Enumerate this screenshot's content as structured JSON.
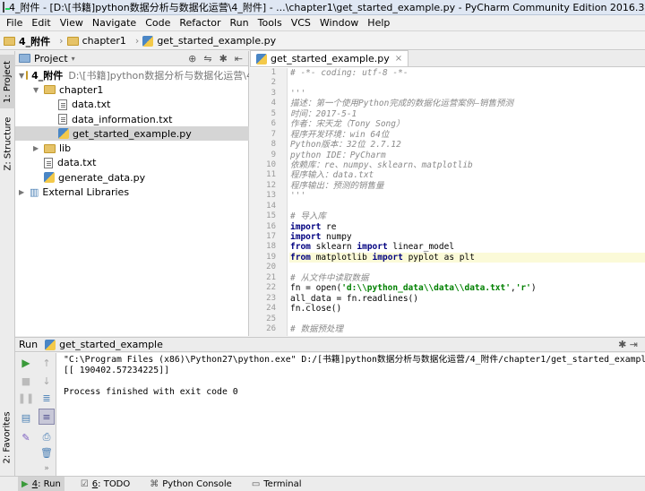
{
  "window": {
    "title": "4_附件 - [D:\\[书籍]python数据分析与数据化运营\\4_附件] - ...\\chapter1\\get_started_example.py - PyCharm Community Edition 2016.3.2"
  },
  "menu": [
    "File",
    "Edit",
    "View",
    "Navigate",
    "Code",
    "Refactor",
    "Run",
    "Tools",
    "VCS",
    "Window",
    "Help"
  ],
  "breadcrumb": [
    "4_附件",
    "chapter1",
    "get_started_example.py"
  ],
  "left_tabs": {
    "project": "1: Project",
    "structure": "Z: Structure",
    "favorites": "2: Favorites"
  },
  "project_panel": {
    "header": "Project",
    "tree": [
      {
        "label": "4_附件",
        "extra": "D:\\[书籍]python数据分析与数据化运营\\4_附件",
        "kind": "folder",
        "depth": 0,
        "expanded": true
      },
      {
        "label": "chapter1",
        "kind": "folder",
        "depth": 1,
        "expanded": true
      },
      {
        "label": "data.txt",
        "kind": "txt",
        "depth": 2
      },
      {
        "label": "data_information.txt",
        "kind": "txt",
        "depth": 2
      },
      {
        "label": "get_started_example.py",
        "kind": "py",
        "depth": 2,
        "selected": true
      },
      {
        "label": "lib",
        "kind": "folder",
        "depth": 1,
        "expanded": false
      },
      {
        "label": "data.txt",
        "kind": "txt",
        "depth": 1
      },
      {
        "label": "generate_data.py",
        "kind": "py",
        "depth": 1
      },
      {
        "label": "External Libraries",
        "kind": "lib",
        "depth": 0,
        "expanded": false
      }
    ]
  },
  "editor": {
    "tab": "get_started_example.py",
    "current_line": 19,
    "lines": [
      {
        "n": "1",
        "text": "# -*- coding: utf-8 -*-",
        "type": "cm"
      },
      {
        "n": "2",
        "text": "",
        "type": "nm"
      },
      {
        "n": "3",
        "text": "'''",
        "type": "cm"
      },
      {
        "n": "4",
        "text": "描述：第一个使用Python完成的数据化运营案例—销售预测",
        "type": "cm"
      },
      {
        "n": "5",
        "text": "时间：2017-5-1",
        "type": "cm"
      },
      {
        "n": "6",
        "text": "作者：宋天龙（Tony Song）",
        "type": "cm"
      },
      {
        "n": "7",
        "text": "程序开发环境：win 64位",
        "type": "cm"
      },
      {
        "n": "8",
        "text": "Python版本：32位 2.7.12",
        "type": "cm"
      },
      {
        "n": "9",
        "text": "python IDE：PyCharm",
        "type": "cm"
      },
      {
        "n": "10",
        "text": "依赖库：re、numpy、sklearn、matplotlib",
        "type": "cm"
      },
      {
        "n": "11",
        "text": "程序输入：data.txt",
        "type": "cm"
      },
      {
        "n": "12",
        "text": "程序输出：预测的销售量",
        "type": "cm"
      },
      {
        "n": "13",
        "text": "'''",
        "type": "cm"
      },
      {
        "n": "14",
        "text": "",
        "type": "nm"
      },
      {
        "n": "15",
        "text": "# 导入库",
        "type": "cm"
      },
      {
        "n": "16",
        "kw": "import",
        "rest": " re",
        "type": "code"
      },
      {
        "n": "17",
        "kw": "import",
        "rest": " numpy",
        "type": "code"
      },
      {
        "n": "18",
        "kw": "from",
        "rest": " sklearn ",
        "kw2": "import",
        "rest2": " linear_model",
        "type": "code"
      },
      {
        "n": "19",
        "kw": "from",
        "rest": " matplotlib ",
        "kw2": "import",
        "rest2": " pyplot as plt",
        "type": "code"
      },
      {
        "n": "20",
        "text": "",
        "type": "nm"
      },
      {
        "n": "21",
        "text": "# 从文件中读取数据",
        "type": "cm"
      },
      {
        "n": "22",
        "pre": "fn = open(",
        "s1": "'d:\\\\python_data\\\\data\\\\data.txt'",
        "mid": ",",
        "s2": "'r'",
        "post": ")",
        "type": "str"
      },
      {
        "n": "23",
        "text": "all_data = fn.readlines()",
        "type": "nm"
      },
      {
        "n": "24",
        "text": "fn.close()",
        "type": "nm"
      },
      {
        "n": "25",
        "text": "",
        "type": "nm"
      },
      {
        "n": "26",
        "text": "# 数据预处理",
        "type": "cm"
      }
    ]
  },
  "run": {
    "header_label": "Run",
    "config": "get_started_example",
    "console": [
      "\"C:\\Program Files (x86)\\Python27\\python.exe\" D:/[书籍]python数据分析与数据化运营/4_附件/chapter1/get_started_example.py",
      "[[ 190402.57234225]]",
      "",
      "Process finished with exit code 0"
    ]
  },
  "bottom_tabs": [
    {
      "key": "4",
      "label": ": Run",
      "active": true
    },
    {
      "key": "6",
      "label": ": TODO",
      "active": false
    },
    {
      "key": "",
      "label": "Python Console",
      "active": false
    },
    {
      "key": "",
      "label": "Terminal",
      "active": false
    }
  ]
}
